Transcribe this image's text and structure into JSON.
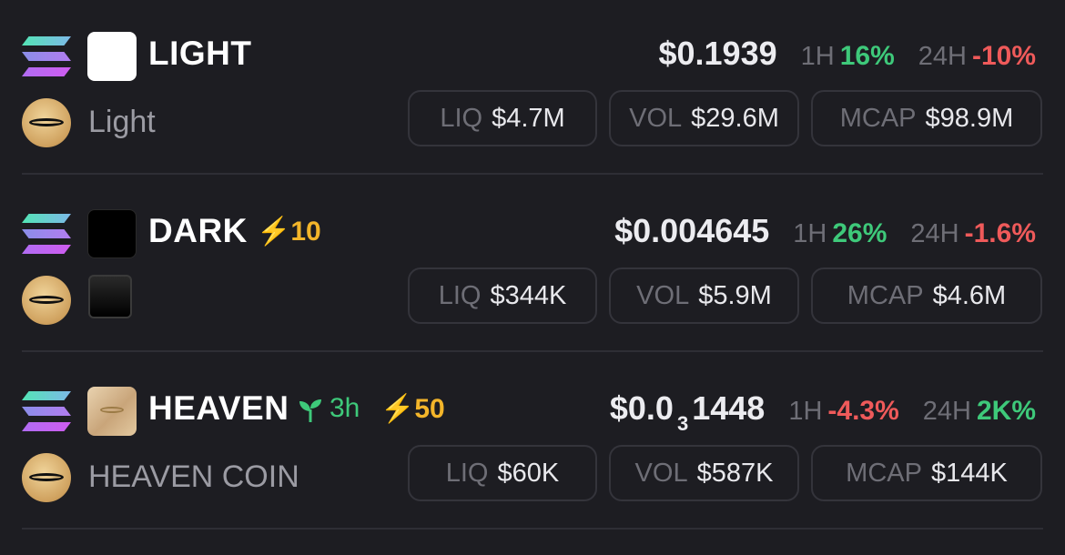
{
  "tokens": [
    {
      "symbol": "LIGHT",
      "name": "Light",
      "price": "$0.1939",
      "h1_label": "1H",
      "h1": "16%",
      "h24_label": "24H",
      "h24": "-10%",
      "liq_label": "LIQ",
      "liq": "$4.7M",
      "vol_label": "VOL",
      "vol": "$29.6M",
      "mcap_label": "MCAP",
      "mcap": "$98.9M"
    },
    {
      "symbol": "DARK",
      "boost": "⚡10",
      "price": "$0.004645",
      "h1_label": "1H",
      "h1": "26%",
      "h24_label": "24H",
      "h24": "-1.6%",
      "liq_label": "LIQ",
      "liq": "$344K",
      "vol_label": "VOL",
      "vol": "$5.9M",
      "mcap_label": "MCAP",
      "mcap": "$4.6M"
    },
    {
      "symbol": "HEAVEN",
      "age": "3h",
      "boost": "⚡50",
      "name": "HEAVEN COIN",
      "price_prefix": "$0.0",
      "price_zeros": "3",
      "price_digits": "1448",
      "h1_label": "1H",
      "h1": "-4.3%",
      "h24_label": "24H",
      "h24": "2K%",
      "liq_label": "LIQ",
      "liq": "$60K",
      "vol_label": "VOL",
      "vol": "$587K",
      "mcap_label": "MCAP",
      "mcap": "$144K"
    }
  ],
  "icons": {
    "chain": "solana-icon",
    "platform": "halo-icon",
    "age": "sprout-icon",
    "boost": "lightning-icon"
  },
  "colors": {
    "background": "#1d1d22",
    "positive": "#3ec97a",
    "negative": "#ef5a5a",
    "boost": "#f3b52a",
    "muted": "#6e6e76"
  }
}
